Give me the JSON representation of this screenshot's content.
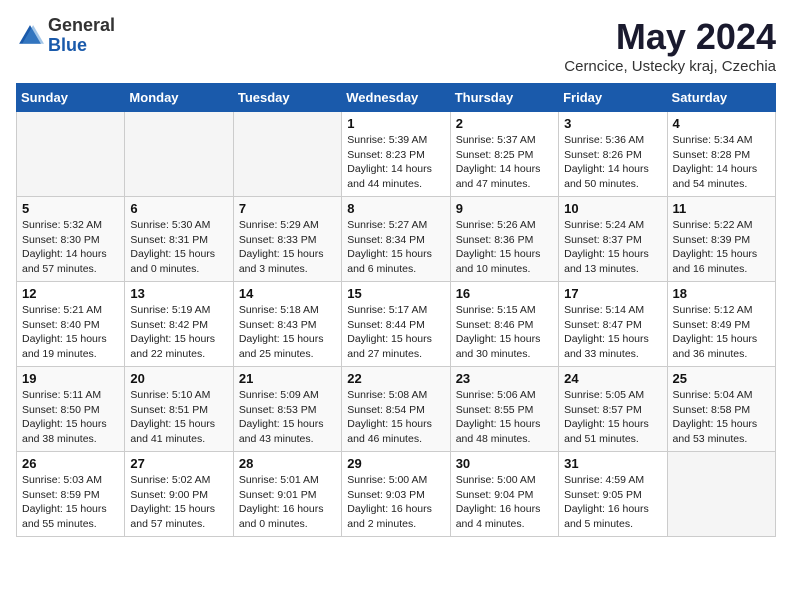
{
  "header": {
    "logo_general": "General",
    "logo_blue": "Blue",
    "month_title": "May 2024",
    "location": "Cerncice, Ustecky kraj, Czechia"
  },
  "weekdays": [
    "Sunday",
    "Monday",
    "Tuesday",
    "Wednesday",
    "Thursday",
    "Friday",
    "Saturday"
  ],
  "weeks": [
    [
      {
        "day": "",
        "info": ""
      },
      {
        "day": "",
        "info": ""
      },
      {
        "day": "",
        "info": ""
      },
      {
        "day": "1",
        "info": "Sunrise: 5:39 AM\nSunset: 8:23 PM\nDaylight: 14 hours\nand 44 minutes."
      },
      {
        "day": "2",
        "info": "Sunrise: 5:37 AM\nSunset: 8:25 PM\nDaylight: 14 hours\nand 47 minutes."
      },
      {
        "day": "3",
        "info": "Sunrise: 5:36 AM\nSunset: 8:26 PM\nDaylight: 14 hours\nand 50 minutes."
      },
      {
        "day": "4",
        "info": "Sunrise: 5:34 AM\nSunset: 8:28 PM\nDaylight: 14 hours\nand 54 minutes."
      }
    ],
    [
      {
        "day": "5",
        "info": "Sunrise: 5:32 AM\nSunset: 8:30 PM\nDaylight: 14 hours\nand 57 minutes."
      },
      {
        "day": "6",
        "info": "Sunrise: 5:30 AM\nSunset: 8:31 PM\nDaylight: 15 hours\nand 0 minutes."
      },
      {
        "day": "7",
        "info": "Sunrise: 5:29 AM\nSunset: 8:33 PM\nDaylight: 15 hours\nand 3 minutes."
      },
      {
        "day": "8",
        "info": "Sunrise: 5:27 AM\nSunset: 8:34 PM\nDaylight: 15 hours\nand 6 minutes."
      },
      {
        "day": "9",
        "info": "Sunrise: 5:26 AM\nSunset: 8:36 PM\nDaylight: 15 hours\nand 10 minutes."
      },
      {
        "day": "10",
        "info": "Sunrise: 5:24 AM\nSunset: 8:37 PM\nDaylight: 15 hours\nand 13 minutes."
      },
      {
        "day": "11",
        "info": "Sunrise: 5:22 AM\nSunset: 8:39 PM\nDaylight: 15 hours\nand 16 minutes."
      }
    ],
    [
      {
        "day": "12",
        "info": "Sunrise: 5:21 AM\nSunset: 8:40 PM\nDaylight: 15 hours\nand 19 minutes."
      },
      {
        "day": "13",
        "info": "Sunrise: 5:19 AM\nSunset: 8:42 PM\nDaylight: 15 hours\nand 22 minutes."
      },
      {
        "day": "14",
        "info": "Sunrise: 5:18 AM\nSunset: 8:43 PM\nDaylight: 15 hours\nand 25 minutes."
      },
      {
        "day": "15",
        "info": "Sunrise: 5:17 AM\nSunset: 8:44 PM\nDaylight: 15 hours\nand 27 minutes."
      },
      {
        "day": "16",
        "info": "Sunrise: 5:15 AM\nSunset: 8:46 PM\nDaylight: 15 hours\nand 30 minutes."
      },
      {
        "day": "17",
        "info": "Sunrise: 5:14 AM\nSunset: 8:47 PM\nDaylight: 15 hours\nand 33 minutes."
      },
      {
        "day": "18",
        "info": "Sunrise: 5:12 AM\nSunset: 8:49 PM\nDaylight: 15 hours\nand 36 minutes."
      }
    ],
    [
      {
        "day": "19",
        "info": "Sunrise: 5:11 AM\nSunset: 8:50 PM\nDaylight: 15 hours\nand 38 minutes."
      },
      {
        "day": "20",
        "info": "Sunrise: 5:10 AM\nSunset: 8:51 PM\nDaylight: 15 hours\nand 41 minutes."
      },
      {
        "day": "21",
        "info": "Sunrise: 5:09 AM\nSunset: 8:53 PM\nDaylight: 15 hours\nand 43 minutes."
      },
      {
        "day": "22",
        "info": "Sunrise: 5:08 AM\nSunset: 8:54 PM\nDaylight: 15 hours\nand 46 minutes."
      },
      {
        "day": "23",
        "info": "Sunrise: 5:06 AM\nSunset: 8:55 PM\nDaylight: 15 hours\nand 48 minutes."
      },
      {
        "day": "24",
        "info": "Sunrise: 5:05 AM\nSunset: 8:57 PM\nDaylight: 15 hours\nand 51 minutes."
      },
      {
        "day": "25",
        "info": "Sunrise: 5:04 AM\nSunset: 8:58 PM\nDaylight: 15 hours\nand 53 minutes."
      }
    ],
    [
      {
        "day": "26",
        "info": "Sunrise: 5:03 AM\nSunset: 8:59 PM\nDaylight: 15 hours\nand 55 minutes."
      },
      {
        "day": "27",
        "info": "Sunrise: 5:02 AM\nSunset: 9:00 PM\nDaylight: 15 hours\nand 57 minutes."
      },
      {
        "day": "28",
        "info": "Sunrise: 5:01 AM\nSunset: 9:01 PM\nDaylight: 16 hours\nand 0 minutes."
      },
      {
        "day": "29",
        "info": "Sunrise: 5:00 AM\nSunset: 9:03 PM\nDaylight: 16 hours\nand 2 minutes."
      },
      {
        "day": "30",
        "info": "Sunrise: 5:00 AM\nSunset: 9:04 PM\nDaylight: 16 hours\nand 4 minutes."
      },
      {
        "day": "31",
        "info": "Sunrise: 4:59 AM\nSunset: 9:05 PM\nDaylight: 16 hours\nand 5 minutes."
      },
      {
        "day": "",
        "info": ""
      }
    ]
  ]
}
